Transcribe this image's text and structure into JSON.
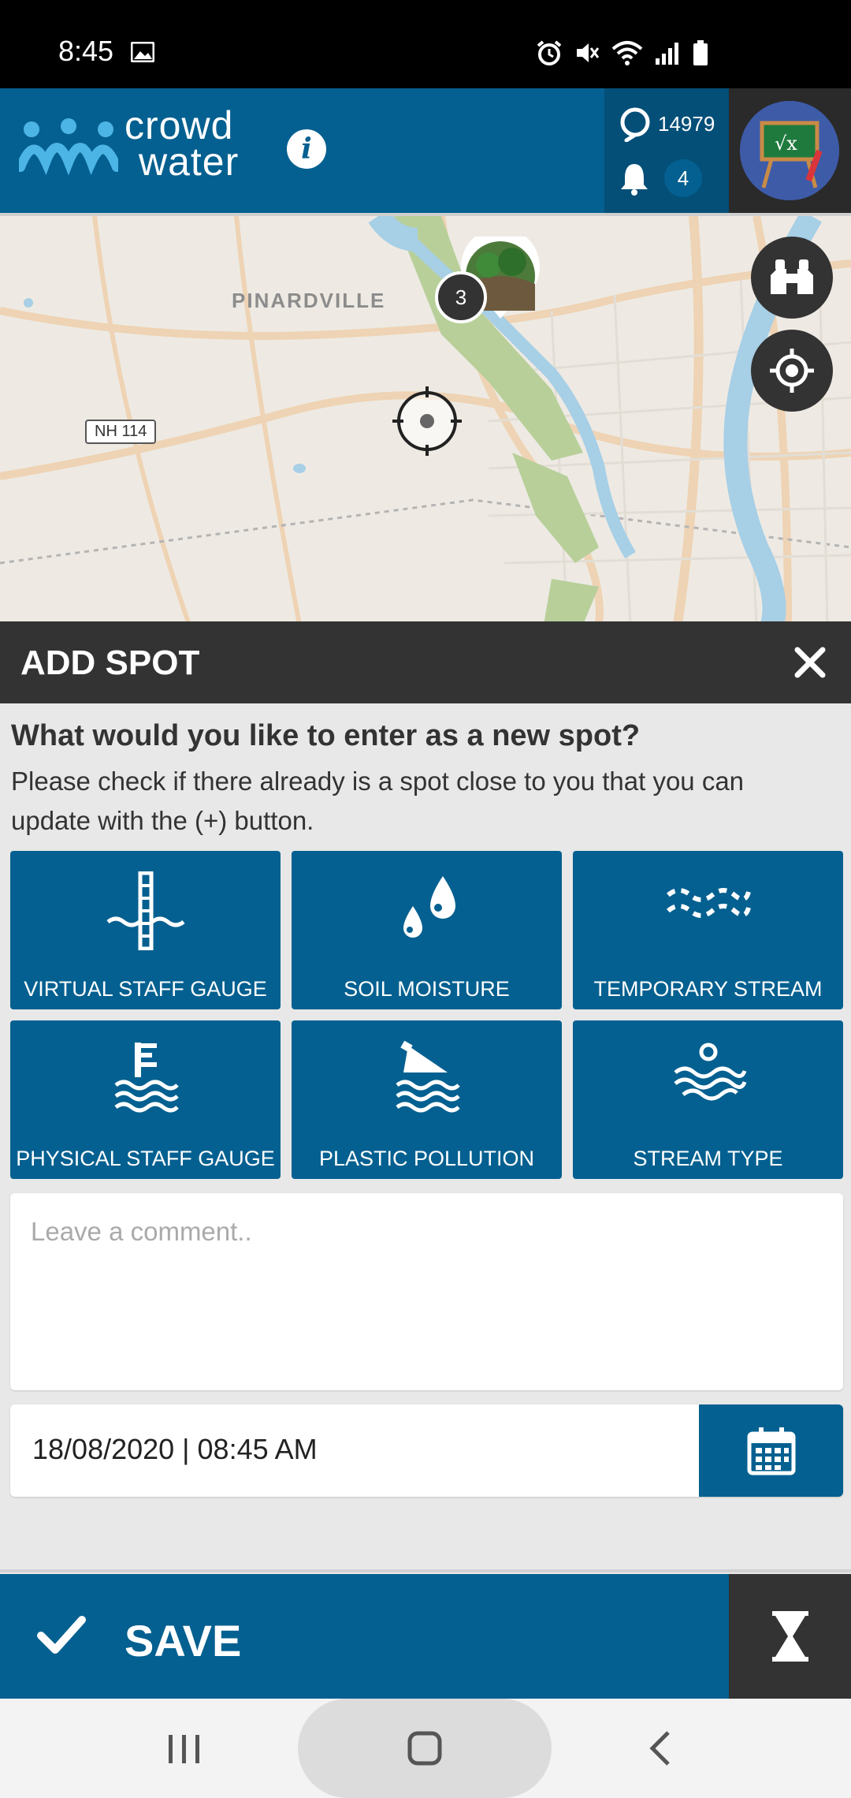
{
  "status_bar": {
    "time": "8:45"
  },
  "header": {
    "logo_line1": "crowd",
    "logo_line2": "water",
    "info_label": "i",
    "points": "14979",
    "notifications": "4"
  },
  "map": {
    "town_label": "PINARDVILLE",
    "route_label": "NH 114",
    "cluster_count": "3"
  },
  "panel": {
    "title": "ADD SPOT",
    "question": "What would you like to enter as a new spot?",
    "hint": "Please check if there already is a spot close to you that you can update with the (+) button.",
    "tiles": [
      {
        "label": "VIRTUAL STAFF GAUGE",
        "icon": "virtual-staff-gauge-icon"
      },
      {
        "label": "SOIL MOISTURE",
        "icon": "soil-moisture-icon"
      },
      {
        "label": "TEMPORARY STREAM",
        "icon": "temporary-stream-icon"
      },
      {
        "label": "PHYSICAL STAFF GAUGE",
        "icon": "physical-staff-gauge-icon"
      },
      {
        "label": "PLASTIC POLLUTION",
        "icon": "plastic-pollution-icon"
      },
      {
        "label": "STREAM TYPE",
        "icon": "stream-type-icon"
      }
    ],
    "comment_placeholder": "Leave a comment..",
    "datetime": "18/08/2020 | 08:45 AM"
  },
  "footer": {
    "save_label": "SAVE"
  },
  "colors": {
    "brand": "#046090",
    "dark": "#333333",
    "background": "#e8e8e8"
  }
}
